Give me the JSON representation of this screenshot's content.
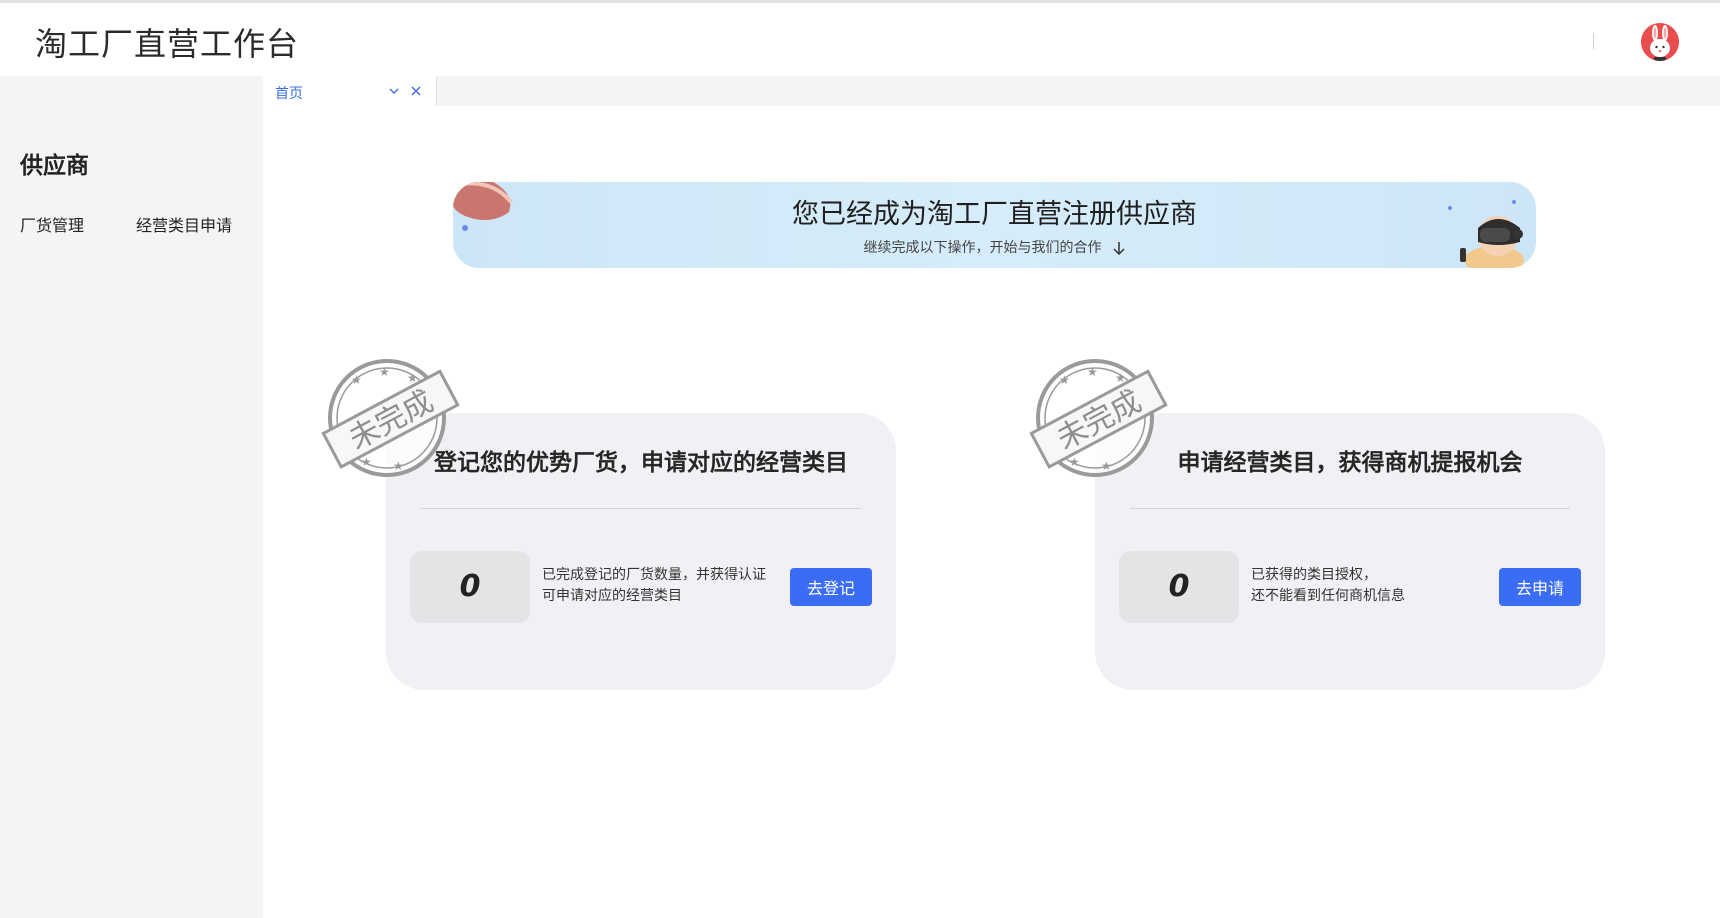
{
  "header": {
    "app_title": "淘工厂直营工作台",
    "avatar_icon": "rabbit-avatar-icon"
  },
  "sidebar": {
    "section_title": "供应商",
    "items": [
      {
        "label": "厂货管理"
      },
      {
        "label": "经营类目申请"
      }
    ]
  },
  "tabs": [
    {
      "label": "首页",
      "active": true,
      "icons": [
        "chevron-down-icon",
        "close-icon"
      ]
    }
  ],
  "banner": {
    "title": "您已经成为淘工厂直营注册供应商",
    "subtitle": "继续完成以下操作，开始与我们的合作"
  },
  "cards": [
    {
      "stamp": "未完成",
      "title": "登记您的优势厂货，申请对应的经营类目",
      "count": "0",
      "desc_line1": "已完成登记的厂货数量，并获得认证",
      "desc_line2": "可申请对应的经营类目",
      "button": "去登记"
    },
    {
      "stamp": "未完成",
      "title": "申请经营类目，获得商机提报机会",
      "count": "0",
      "desc_line1": "已获得的类目授权，",
      "desc_line2": "还不能看到任何商机信息",
      "button": "去申请"
    }
  ],
  "colors": {
    "accent": "#3a6cf4",
    "tab_active_text": "#3b6fe6",
    "banner_bg": "#d3e9f8",
    "card_bg": "#f1f1f5",
    "stamp_gray": "#9a9a9a"
  }
}
